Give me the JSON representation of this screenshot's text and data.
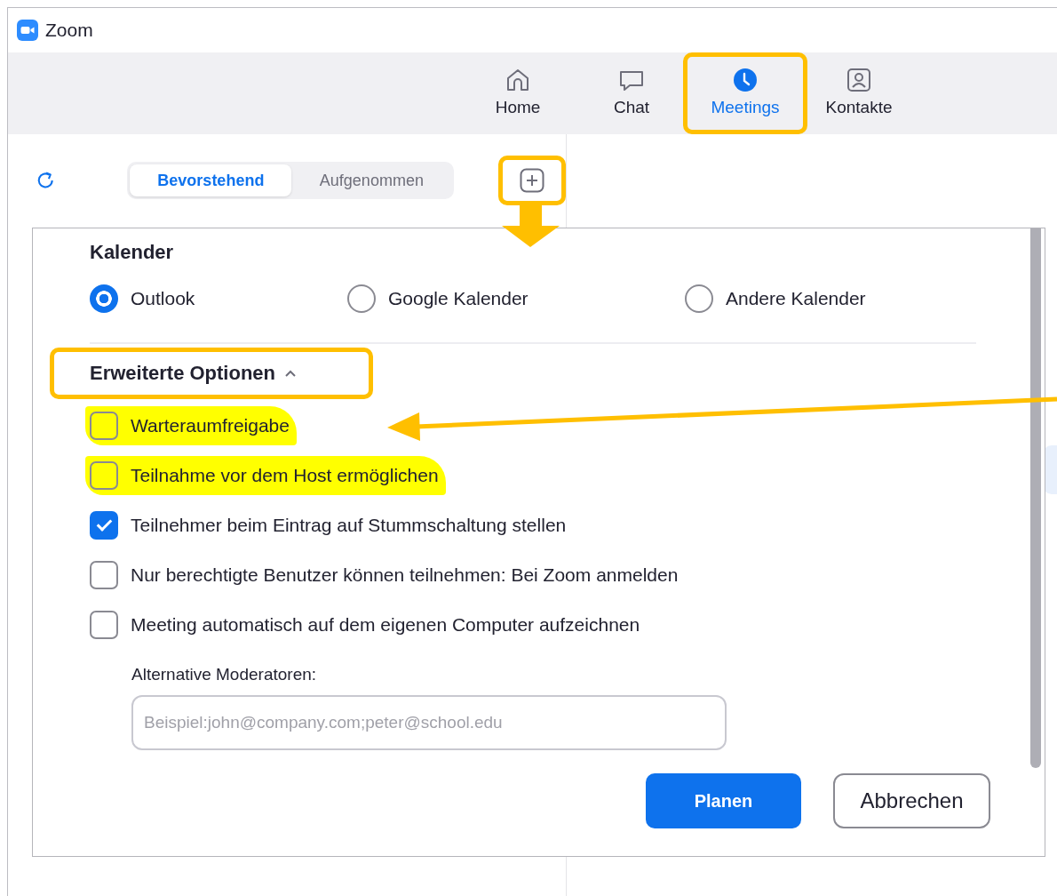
{
  "window": {
    "title": "Zoom"
  },
  "nav_tabs": [
    {
      "label": "Home",
      "kind": "home",
      "selected": false,
      "outlined": false
    },
    {
      "label": "Chat",
      "kind": "chat",
      "selected": false,
      "outlined": false
    },
    {
      "label": "Meetings",
      "kind": "clock",
      "selected": true,
      "outlined": true
    },
    {
      "label": "Kontakte",
      "kind": "contact",
      "selected": false,
      "outlined": false
    }
  ],
  "meetings_panel": {
    "segments": [
      {
        "label": "Bevorstehend",
        "selected": true
      },
      {
        "label": "Aufgenommen",
        "selected": false
      }
    ],
    "add_button": {
      "outlined": true
    }
  },
  "dialog": {
    "calendar": {
      "title": "Kalender",
      "options": [
        {
          "label": "Outlook",
          "selected": true
        },
        {
          "label": "Google Kalender",
          "selected": false
        },
        {
          "label": "Andere Kalender",
          "selected": false
        }
      ]
    },
    "advanced": {
      "title": "Erweiterte Optionen",
      "expanded": true,
      "outlined": true,
      "options": [
        {
          "label": "Warteraumfreigabe",
          "checked": false,
          "highlighted": true
        },
        {
          "label": "Teilnahme vor dem Host ermöglichen",
          "checked": false,
          "highlighted": true
        },
        {
          "label": "Teilnehmer beim Eintrag auf Stummschaltung stellen",
          "checked": true,
          "highlighted": false
        },
        {
          "label": "Nur berechtigte Benutzer können teilnehmen: Bei Zoom anmelden",
          "checked": false,
          "highlighted": false
        },
        {
          "label": "Meeting automatisch auf dem eigenen Computer aufzeichnen",
          "checked": false,
          "highlighted": false
        }
      ]
    },
    "alt_hosts": {
      "label": "Alternative Moderatoren:",
      "placeholder": "Beispiel:john@company.com;peter@school.edu"
    },
    "buttons": [
      {
        "label": "Planen",
        "kind": "primary"
      },
      {
        "label": "Abbrechen",
        "kind": "secondary"
      }
    ]
  }
}
